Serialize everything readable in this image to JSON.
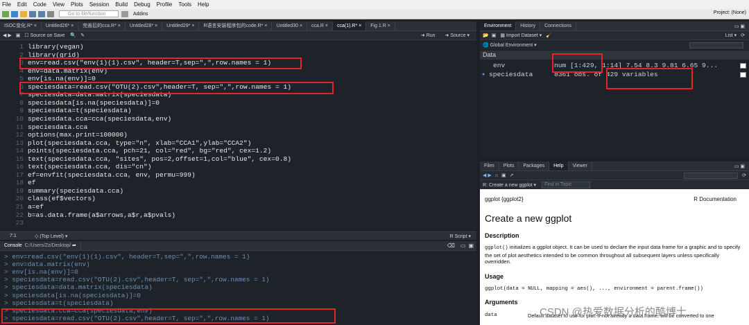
{
  "menubar": {
    "items": [
      "File",
      "Edit",
      "Code",
      "View",
      "Plots",
      "Session",
      "Build",
      "Debug",
      "Profile",
      "Tools",
      "Help"
    ]
  },
  "toolbar": {
    "goto_placeholder": "Go to file/function",
    "addins_label": "Addins",
    "project_label": "Project: (None)"
  },
  "editor": {
    "tabs": [
      "ISOC变化.R*",
      "Untitled26*",
      "完善后的cca.R*",
      "Untitled28*",
      "Untitled29*",
      "R语言安装程序包的code.R*",
      "Untitled30",
      "cca.R",
      "cca(1).R*",
      "Fig 1.R"
    ],
    "active_tab_index": 8,
    "source_on_save": "Source on Save",
    "run_label": "Run",
    "source_label": "Source",
    "lines": [
      {
        "n": "1",
        "t": "library(vegan)"
      },
      {
        "n": "2",
        "t": "library(grid)"
      },
      {
        "n": "3",
        "t": "env=read.csv(\"env(1)(1).csv\", header=T,sep=\",\",row.names = 1)"
      },
      {
        "n": "4",
        "t": "env=data.matrix(env)"
      },
      {
        "n": "5",
        "t": "env[is.na(env)]=0"
      },
      {
        "n": "6",
        "t": "speciesdata=read.csv(\"OTU(2).csv\",header=T, sep=\",\",row.names = 1)"
      },
      {
        "n": "7",
        "t": "speciesdata=data.matrix(speciesdata)"
      },
      {
        "n": "8",
        "t": "speciesdata[is.na(speciesdata)]=0"
      },
      {
        "n": "9",
        "t": "speciesdata=t(speciesdata)"
      },
      {
        "n": "10",
        "t": "speciesdata.cca=cca(speciesdata,env)"
      },
      {
        "n": "11",
        "t": "speciesdata.cca"
      },
      {
        "n": "12",
        "t": "options(max.print=100000)"
      },
      {
        "n": "13",
        "t": "plot(speciesdata.cca, type=\"n\", xlab=\"CCA1\",ylab=\"CCA2\")"
      },
      {
        "n": "14",
        "t": "points(speciesdata.cca, pch=21, col=\"red\", bg=\"red\", cex=1.2)"
      },
      {
        "n": "15",
        "t": "text(speciesdata.cca, \"sites\", pos=2,offset=1,col=\"blue\", cex=0.8)"
      },
      {
        "n": "16",
        "t": "text(speciesdata.cca, dis=\"cn\")"
      },
      {
        "n": "17",
        "t": "ef=envfit(speciesdata.cca, env, permu=999)"
      },
      {
        "n": "18",
        "t": "ef"
      },
      {
        "n": "19",
        "t": "summary(speciesdata.cca)"
      },
      {
        "n": "20",
        "t": "class(ef$vectors)"
      },
      {
        "n": "21",
        "t": "a=ef"
      },
      {
        "n": "22",
        "t": "b=as.data.frame(a$arrows,a$r,a$pvals)"
      },
      {
        "n": "23",
        "t": ""
      }
    ],
    "status_pos": "7:1",
    "status_level": "(Top Level)",
    "status_type": "R Script"
  },
  "console": {
    "tab_label": "Console",
    "path": "C:/Users/Zz/Desktop/",
    "lines": [
      "> env=read.csv(\"env(1)(1).csv\", header=T,sep=\",\",row.names = 1)",
      "> env=data.matrix(env)",
      "> env[is.na(env)]=0",
      "> speciesdata=read.csv(\"OTU(2).csv\",header=T, sep=\",\",row.names = 1)",
      "> speciesdata=data.matrix(speciesdata)",
      "> speciesdata[is.na(speciesdata)]=0",
      "> speciesdata=t(speciesdata)",
      "> speciesdata.cca=cca(speciesdata,env)",
      "> speciesdata=read.csv(\"OTU(2).csv\",header=T, sep=\",\",row.names = 1)"
    ]
  },
  "environment": {
    "tabs": [
      "Environment",
      "History",
      "Connections"
    ],
    "import_label": "Import Dataset",
    "list_label": "List",
    "scope_label": "Global Environment",
    "section_label": "Data",
    "rows": [
      {
        "name": "env",
        "value": "num [1:429, 1:14] 7.54 8.3 9.81 6.65 9..."
      },
      {
        "name": "speciesdata",
        "value": "8361 obs. of  429 variables"
      }
    ]
  },
  "help": {
    "tabs": [
      "Files",
      "Plots",
      "Packages",
      "Help",
      "Viewer"
    ],
    "topic_crumb": "R: Create a new ggplot",
    "find_placeholder": "Find in Topic",
    "header_left": "ggplot {ggplot2}",
    "header_right": "R Documentation",
    "title": "Create a new ggplot",
    "desc_heading": "Description",
    "desc_code": "ggplot()",
    "desc_text": " initializes a ggplot object. It can be used to declare the input data frame for a graphic and to specify the set of plot aesthetics intended to be common throughout all subsequent layers unless specifically overridden.",
    "usage_heading": "Usage",
    "usage_code": "ggplot(data = NULL, mapping = aes(), ..., environment = parent.frame())",
    "args_heading": "Arguments",
    "arg_name": "data",
    "arg_desc": "Default dataset to use for plot. If not already a data.frame, will be converted to one"
  },
  "watermark": "CSDN @热爱数据分析的酷博士",
  "colors": {
    "highlight": "#e8222a",
    "console_text": "#6c8fb3",
    "help_heading": "#111111"
  }
}
